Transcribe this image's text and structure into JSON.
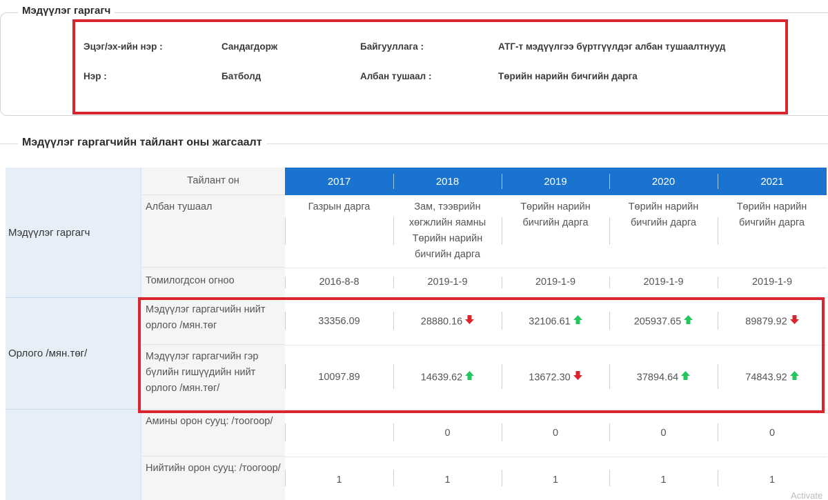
{
  "declarant": {
    "legend": "Мэдүүлэг гаргагч",
    "surname_label": "Эцэг/эх-ийн нэр :",
    "surname_value": "Сандагдорж",
    "name_label": "Нэр :",
    "name_value": "Батболд",
    "org_label": "Байгууллага :",
    "org_value": "АТГ-т мэдүүлгээ бүртгүүлдэг албан тушаалтнууд",
    "position_label": "Албан тушаал :",
    "position_value": "Төрийн нарийн бичгийн дарга"
  },
  "report": {
    "legend": "Мэдүүлэг гаргагчийн тайлант оны жагсаалт",
    "year_header_label": "Тайлант он",
    "years": [
      "2017",
      "2018",
      "2019",
      "2020",
      "2021"
    ],
    "categories": {
      "declarant": "Мэдүүлэг гаргагч",
      "income": "Орлого /мян.төг/"
    },
    "rows": {
      "position": {
        "label": "Албан тушаал",
        "values": [
          "Газрын дарга",
          "Зам, тээврийн хөгжлийн яамны Төрийн нарийн бичгийн дарга",
          "Төрийн нарийн бичгийн дарга",
          "Төрийн нарийн бичгийн дарга",
          "Төрийн нарийн бичгийн дарга"
        ]
      },
      "appointed": {
        "label": "Томилогдсон огноо",
        "values": [
          "2016-8-8",
          "2019-1-9",
          "2019-1-9",
          "2019-1-9",
          "2019-1-9"
        ]
      },
      "total_income": {
        "label": "Мэдүүлэг гаргагчийн нийт орлого /мян.төг",
        "values": [
          "33356.09",
          "28880.16",
          "32106.61",
          "205937.65",
          "89879.92"
        ],
        "trend": [
          "",
          "down",
          "up",
          "up",
          "down"
        ]
      },
      "family_income": {
        "label": "Мэдүүлэг гаргагчийн гэр бүлийн гишүүдийн нийт орлого /мян.төг/",
        "values": [
          "10097.89",
          "14639.62",
          "13672.30",
          "37894.64",
          "74843.92"
        ],
        "trend": [
          "",
          "up",
          "down",
          "up",
          "up"
        ]
      },
      "private_housing": {
        "label": "Амины орон сууц: /тоогоор/",
        "values": [
          "",
          "0",
          "0",
          "0",
          "0"
        ]
      },
      "apartment": {
        "label": "Нийтийн орон сууц: /тоогоор/",
        "values": [
          "1",
          "1",
          "1",
          "1",
          "1"
        ]
      }
    },
    "colors": {
      "up": "#22c55e",
      "down": "#d9262e",
      "header": "#1a73cf",
      "highlight": "#d9262e"
    }
  },
  "watermark": "Activate"
}
